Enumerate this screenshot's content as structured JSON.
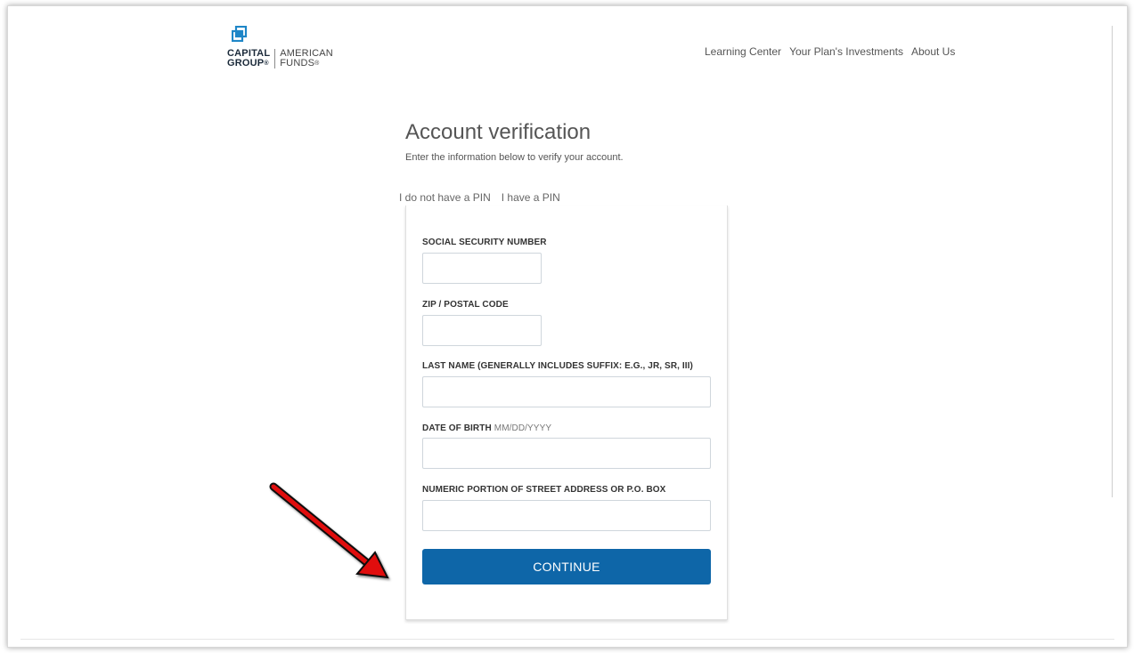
{
  "logo": {
    "left_line1": "CAPITAL",
    "left_line2": "GROUP",
    "right_line1": "AMERICAN",
    "right_line2": "FUNDS",
    "reg": "®"
  },
  "nav": {
    "items": [
      "Learning Center",
      "Your Plan's Investments",
      "About Us"
    ]
  },
  "page": {
    "title": "Account verification",
    "subtitle": "Enter the information below to verify your account."
  },
  "tabs": [
    "I do not have a PIN",
    "I have a PIN"
  ],
  "form": {
    "ssn_label": "SOCIAL SECURITY NUMBER",
    "zip_label": "ZIP / POSTAL CODE",
    "lastname_label": "LAST NAME (GENERALLY INCLUDES SUFFIX: E.G., JR, SR, III)",
    "dob_label": "DATE OF BIRTH",
    "dob_hint": "MM/DD/YYYY",
    "street_label": "NUMERIC PORTION OF STREET ADDRESS OR P.O. BOX",
    "continue_label": "CONTINUE"
  },
  "colors": {
    "button": "#0e66a8",
    "arrow": "#e01010",
    "logo_blue": "#1e86c7"
  },
  "icons": {
    "logo_mark": "capital-group-mark-icon",
    "annotation": "red-arrow-icon"
  }
}
